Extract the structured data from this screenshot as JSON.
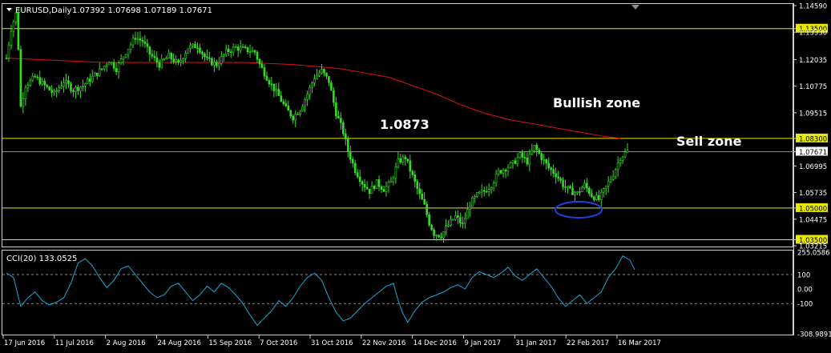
{
  "header": {
    "symbol_label": "EURUSD,Daily",
    "ohlc": "1.07392 1.07698 1.07189 1.07671"
  },
  "annotations": {
    "bullish": "Bullish zone",
    "sell": "Sell zone",
    "peak": "1.0873"
  },
  "colors": {
    "background": "#000000",
    "bull_candle": "#33dd22",
    "moving_average": "#e01010",
    "level_line": "#e8e800",
    "cci_line": "#1aa7d6",
    "ellipse": "#1f3fe0"
  },
  "chart_data": [
    {
      "type": "candlestick",
      "title": "EURUSD,Daily",
      "x_tick_labels": [
        "17 Jun 2016",
        "11 Jul 2016",
        "2 Aug 2016",
        "24 Aug 2016",
        "15 Sep 2016",
        "7 Oct 2016",
        "31 Oct 2016",
        "22 Nov 2016",
        "14 Dec 2016",
        "9 Jan 2017",
        "31 Jan 2017",
        "22 Feb 2017",
        "16 Mar 2017"
      ],
      "y_tick_labels": [
        "1.14590",
        "1.13500",
        "1.13330",
        "1.12035",
        "1.10775",
        "1.09515",
        "1.08300",
        "1.07671",
        "1.06995",
        "1.05735",
        "1.05000",
        "1.04475",
        "1.03500",
        "1.03215"
      ],
      "ylim": [
        1.03215,
        1.1459
      ],
      "levels": [
        1.135,
        1.083,
        1.05,
        1.035
      ],
      "current_price": 1.07671,
      "moving_average": [
        [
          0,
          1.121
        ],
        [
          20,
          1.12
        ],
        [
          40,
          1.119
        ],
        [
          60,
          1.119
        ],
        [
          80,
          1.119
        ],
        [
          100,
          1.119
        ],
        [
          120,
          1.118
        ],
        [
          140,
          1.116
        ],
        [
          150,
          1.114
        ],
        [
          160,
          1.112
        ],
        [
          170,
          1.108
        ],
        [
          180,
          1.104
        ],
        [
          190,
          1.099
        ],
        [
          200,
          1.095
        ],
        [
          210,
          1.092
        ],
        [
          220,
          1.09
        ],
        [
          230,
          1.088
        ],
        [
          240,
          1.086
        ],
        [
          250,
          1.084
        ],
        [
          257,
          1.083
        ]
      ],
      "price_path": [
        [
          0,
          1.121
        ],
        [
          2,
          1.135
        ],
        [
          4,
          1.142
        ],
        [
          5,
          1.126
        ],
        [
          6,
          1.098
        ],
        [
          8,
          1.108
        ],
        [
          12,
          1.112
        ],
        [
          16,
          1.108
        ],
        [
          20,
          1.104
        ],
        [
          24,
          1.11
        ],
        [
          28,
          1.106
        ],
        [
          32,
          1.108
        ],
        [
          36,
          1.112
        ],
        [
          40,
          1.116
        ],
        [
          43,
          1.12
        ],
        [
          46,
          1.116
        ],
        [
          50,
          1.124
        ],
        [
          54,
          1.131
        ],
        [
          57,
          1.129
        ],
        [
          60,
          1.123
        ],
        [
          64,
          1.118
        ],
        [
          68,
          1.122
        ],
        [
          72,
          1.118
        ],
        [
          76,
          1.126
        ],
        [
          80,
          1.127
        ],
        [
          84,
          1.12
        ],
        [
          88,
          1.118
        ],
        [
          92,
          1.124
        ],
        [
          96,
          1.126
        ],
        [
          100,
          1.125
        ],
        [
          104,
          1.124
        ],
        [
          106,
          1.118
        ],
        [
          110,
          1.11
        ],
        [
          114,
          1.103
        ],
        [
          117,
          1.097
        ],
        [
          120,
          1.093
        ],
        [
          123,
          1.097
        ],
        [
          126,
          1.104
        ],
        [
          129,
          1.112
        ],
        [
          132,
          1.115
        ],
        [
          135,
          1.11
        ],
        [
          138,
          1.095
        ],
        [
          141,
          1.086
        ],
        [
          143,
          1.077
        ],
        [
          146,
          1.068
        ],
        [
          149,
          1.062
        ],
        [
          152,
          1.058
        ],
        [
          155,
          1.062
        ],
        [
          158,
          1.059
        ],
        [
          161,
          1.062
        ],
        [
          164,
          1.072
        ],
        [
          167,
          1.074
        ],
        [
          169,
          1.068
        ],
        [
          171,
          1.062
        ],
        [
          173,
          1.056
        ],
        [
          175,
          1.051
        ],
        [
          177,
          1.043
        ],
        [
          179,
          1.038
        ],
        [
          182,
          1.037
        ],
        [
          185,
          1.042
        ],
        [
          188,
          1.046
        ],
        [
          191,
          1.042
        ],
        [
          194,
          1.052
        ],
        [
          197,
          1.056
        ],
        [
          200,
          1.058
        ],
        [
          203,
          1.061
        ],
        [
          206,
          1.067
        ],
        [
          209,
          1.069
        ],
        [
          212,
          1.071
        ],
        [
          215,
          1.075
        ],
        [
          218,
          1.072
        ],
        [
          221,
          1.079
        ],
        [
          224,
          1.074
        ],
        [
          227,
          1.069
        ],
        [
          230,
          1.066
        ],
        [
          233,
          1.061
        ],
        [
          236,
          1.058
        ],
        [
          239,
          1.057
        ],
        [
          242,
          1.061
        ],
        [
          245,
          1.056
        ],
        [
          248,
          1.054
        ],
        [
          251,
          1.06
        ],
        [
          254,
          1.066
        ],
        [
          257,
          1.074
        ],
        [
          260,
          1.077
        ]
      ]
    },
    {
      "type": "line",
      "title": "CCI(20) 133.0525",
      "y_tick_labels": [
        "255.0586",
        "100",
        "0.00",
        "-100",
        "-308.9891"
      ],
      "ylim": [
        -308.9891,
        255.0586
      ],
      "levels": [
        100,
        -100
      ],
      "cci": [
        [
          0,
          110
        ],
        [
          3,
          80
        ],
        [
          6,
          -120
        ],
        [
          9,
          -60
        ],
        [
          12,
          -20
        ],
        [
          15,
          -80
        ],
        [
          18,
          -110
        ],
        [
          21,
          -90
        ],
        [
          24,
          -60
        ],
        [
          27,
          40
        ],
        [
          30,
          180
        ],
        [
          33,
          210
        ],
        [
          36,
          160
        ],
        [
          39,
          80
        ],
        [
          42,
          10
        ],
        [
          45,
          60
        ],
        [
          48,
          140
        ],
        [
          51,
          160
        ],
        [
          54,
          100
        ],
        [
          57,
          40
        ],
        [
          60,
          -20
        ],
        [
          63,
          -60
        ],
        [
          66,
          -40
        ],
        [
          69,
          20
        ],
        [
          72,
          40
        ],
        [
          75,
          -20
        ],
        [
          78,
          -80
        ],
        [
          81,
          -40
        ],
        [
          84,
          20
        ],
        [
          87,
          -20
        ],
        [
          90,
          40
        ],
        [
          93,
          10
        ],
        [
          96,
          -40
        ],
        [
          99,
          -100
        ],
        [
          102,
          -180
        ],
        [
          105,
          -250
        ],
        [
          108,
          -200
        ],
        [
          111,
          -150
        ],
        [
          114,
          -80
        ],
        [
          117,
          -120
        ],
        [
          120,
          -60
        ],
        [
          123,
          20
        ],
        [
          126,
          80
        ],
        [
          129,
          110
        ],
        [
          132,
          60
        ],
        [
          135,
          -60
        ],
        [
          138,
          -160
        ],
        [
          141,
          -220
        ],
        [
          144,
          -200
        ],
        [
          147,
          -150
        ],
        [
          150,
          -100
        ],
        [
          153,
          -60
        ],
        [
          156,
          -20
        ],
        [
          159,
          20
        ],
        [
          162,
          40
        ],
        [
          164,
          -80
        ],
        [
          166,
          -170
        ],
        [
          168,
          -230
        ],
        [
          171,
          -150
        ],
        [
          174,
          -90
        ],
        [
          177,
          -60
        ],
        [
          180,
          -40
        ],
        [
          183,
          -20
        ],
        [
          186,
          10
        ],
        [
          189,
          30
        ],
        [
          192,
          0
        ],
        [
          195,
          80
        ],
        [
          198,
          120
        ],
        [
          201,
          100
        ],
        [
          204,
          80
        ],
        [
          207,
          110
        ],
        [
          210,
          150
        ],
        [
          213,
          90
        ],
        [
          216,
          60
        ],
        [
          219,
          100
        ],
        [
          222,
          140
        ],
        [
          225,
          80
        ],
        [
          228,
          20
        ],
        [
          231,
          -60
        ],
        [
          234,
          -120
        ],
        [
          237,
          -80
        ],
        [
          240,
          -40
        ],
        [
          243,
          -100
        ],
        [
          246,
          -60
        ],
        [
          249,
          -20
        ],
        [
          252,
          80
        ],
        [
          255,
          140
        ],
        [
          258,
          230
        ],
        [
          261,
          200
        ],
        [
          263,
          133.05
        ]
      ]
    }
  ]
}
